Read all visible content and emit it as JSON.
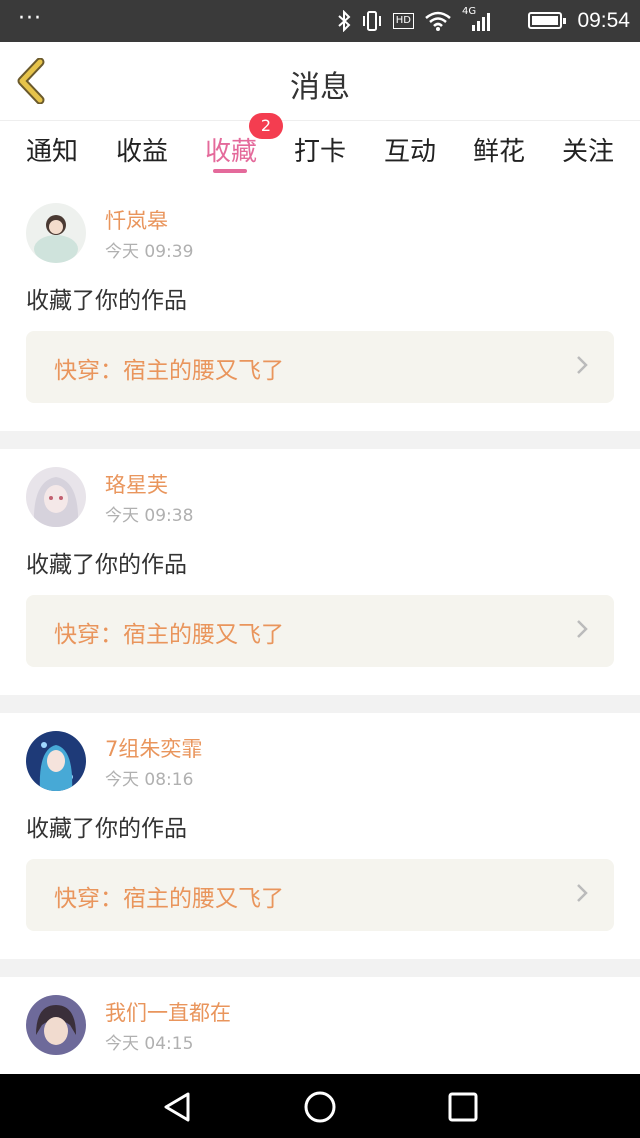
{
  "status_bar": {
    "dots": "···",
    "network": "4G",
    "hd": "HD",
    "time": "09:54",
    "icons": [
      "bluetooth-icon",
      "vibrate-icon",
      "hd-icon",
      "wifi-icon",
      "signal-icon",
      "battery-icon"
    ]
  },
  "header": {
    "title": "消息",
    "back_icon": "chevron-left-icon",
    "accent": "#e6c34a"
  },
  "tabs": [
    {
      "label": "通知",
      "active": false
    },
    {
      "label": "收益",
      "active": false
    },
    {
      "label": "收藏",
      "active": true,
      "badge": "2"
    },
    {
      "label": "打卡",
      "active": false
    },
    {
      "label": "互动",
      "active": false
    },
    {
      "label": "鲜花",
      "active": false
    },
    {
      "label": "关注",
      "active": false
    }
  ],
  "colors": {
    "active_tab": "#e46a9b",
    "badge": "#f43d50",
    "username": "#e9955c",
    "work_bg": "#f5f4ee"
  },
  "messages": [
    {
      "username": "忏岚皋",
      "time": "今天 09:39",
      "action": "收藏了你的作品",
      "work_title": "快穿：宿主的腰又飞了"
    },
    {
      "username": "珞星芙",
      "time": "今天 09:38",
      "action": "收藏了你的作品",
      "work_title": "快穿：宿主的腰又飞了"
    },
    {
      "username": "7组朱奕霏",
      "time": "今天 08:16",
      "action": "收藏了你的作品",
      "work_title": "快穿：宿主的腰又飞了"
    },
    {
      "username": "我们一直都在",
      "time": "今天 04:15"
    }
  ],
  "system_nav": [
    "back-triangle-icon",
    "home-circle-icon",
    "recents-square-icon"
  ]
}
